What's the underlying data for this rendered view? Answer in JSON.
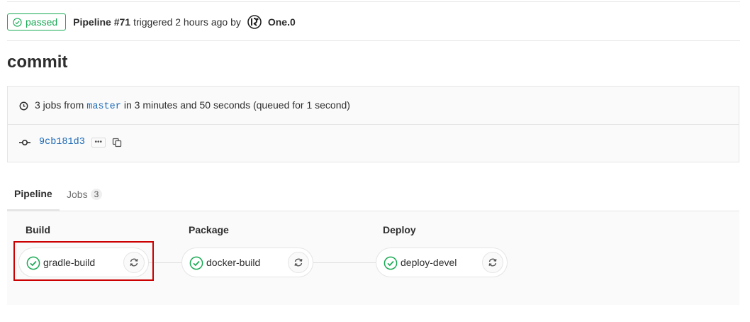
{
  "header": {
    "status_label": "passed",
    "pipeline_label": "Pipeline #71",
    "triggered_text": "triggered 2 hours ago by",
    "user_name": "One.0"
  },
  "commit_title": "commit",
  "info": {
    "jobs_prefix": "3 jobs from",
    "branch": "master",
    "duration_text": "in 3 minutes and 50 seconds (queued for 1 second)",
    "sha": "9cb181d3",
    "ellipsis": "•••"
  },
  "tabs": {
    "pipeline_label": "Pipeline",
    "jobs_label": "Jobs",
    "jobs_count": "3"
  },
  "stages": [
    {
      "title": "Build",
      "job": "gradle-build"
    },
    {
      "title": "Package",
      "job": "docker-build"
    },
    {
      "title": "Deploy",
      "job": "deploy-devel"
    }
  ],
  "colors": {
    "success": "#1aaa55",
    "link": "#1b69b6",
    "highlight": "#cc0000"
  }
}
